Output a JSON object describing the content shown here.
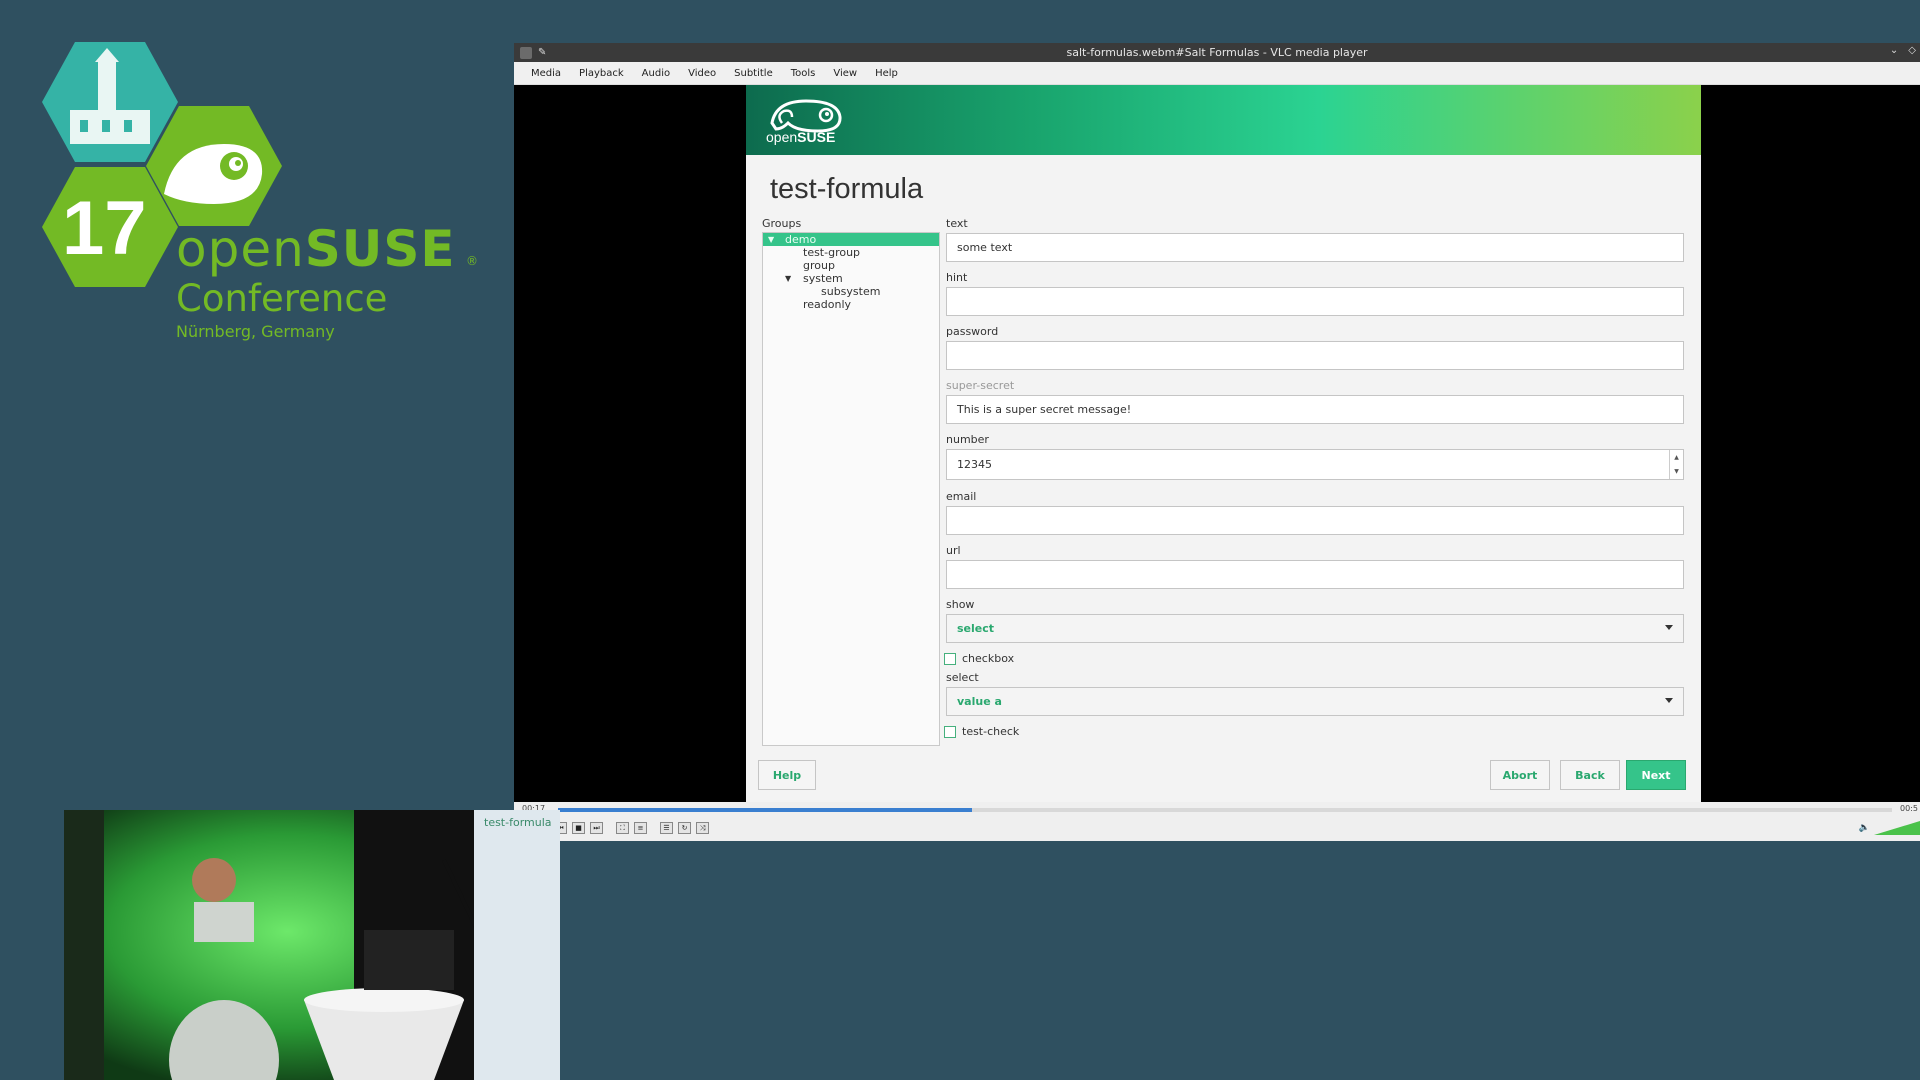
{
  "conference": {
    "number": "17",
    "name_light": "open",
    "name_bold": "SUSE",
    "registered": "®",
    "subtitle": "Conference",
    "location": "Nürnberg, Germany"
  },
  "vlc": {
    "title": "salt-formulas.webm#Salt Formulas - VLC media player",
    "menu": [
      "Media",
      "Playback",
      "Audio",
      "Video",
      "Subtitle",
      "Tools",
      "View",
      "Help"
    ],
    "time_elapsed": "00:17",
    "time_total": "00:5",
    "progress": 0.31,
    "volume": "100%"
  },
  "app": {
    "logo_light": "open",
    "logo_bold": "SUSE",
    "title": "test-formula",
    "groups_label": "Groups",
    "tree": [
      {
        "label": "demo",
        "selected": true,
        "expanded": true
      },
      {
        "label": "test-group"
      },
      {
        "label": "group"
      },
      {
        "label": "system",
        "expanded": true
      },
      {
        "label": "subsystem"
      },
      {
        "label": "readonly"
      }
    ],
    "fields": {
      "text_label": "text",
      "text_value": "some text",
      "hint_label": "hint",
      "hint_value": "",
      "password_label": "password",
      "password_value": "",
      "super_secret_label": "super-secret",
      "super_secret_value": "This is a super secret message!",
      "number_label": "number",
      "number_value": "12345",
      "email_label": "email",
      "email_value": "",
      "url_label": "url",
      "url_value": "",
      "show_label": "show",
      "show_value": "select",
      "checkbox_label": "checkbox",
      "select_label": "select",
      "select_value": "value a",
      "test_check_label": "test-check"
    },
    "buttons": {
      "help": "Help",
      "abort": "Abort",
      "back": "Back",
      "next": "Next"
    }
  },
  "camera": {
    "slide_title": "test-formula"
  },
  "colors": {
    "background": "#2f5060",
    "opensuse_green": "#73ba25",
    "accent": "#35c48a",
    "progress": "#3a7fd0"
  }
}
